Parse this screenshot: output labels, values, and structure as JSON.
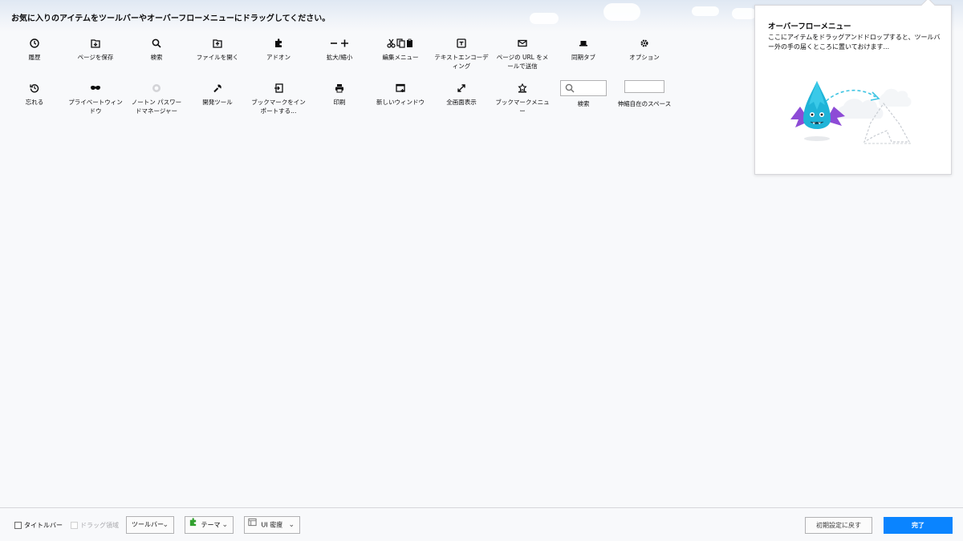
{
  "header": {
    "instructions": "お気に入りのアイテムをツールバーやオーバーフローメニューにドラッグしてください。"
  },
  "palette": {
    "row1": [
      {
        "icon": "clock-icon",
        "label": "履歴"
      },
      {
        "icon": "save-page-icon",
        "label": "ページを保存"
      },
      {
        "icon": "search-icon",
        "label": "検索"
      },
      {
        "icon": "open-file-icon",
        "label": "ファイルを開く"
      },
      {
        "icon": "puzzle-icon",
        "label": "アドオン"
      },
      {
        "icon": "zoom-icon",
        "label": "拡大/縮小"
      },
      {
        "icon": "edit-icon",
        "label": "編集メニュー"
      },
      {
        "icon": "text-encoding-icon",
        "label": "テキストエンコーディング"
      },
      {
        "icon": "mail-icon",
        "label": "ページの URL をメールで送信"
      },
      {
        "icon": "synced-tabs-icon",
        "label": "同期タブ"
      },
      {
        "icon": "gear-icon",
        "label": "オプション"
      }
    ],
    "row2": [
      {
        "icon": "forget-icon",
        "label": "忘れる"
      },
      {
        "icon": "private-mask-icon",
        "label": "プライベートウィンドウ"
      },
      {
        "icon": "norton-icon",
        "label": "ノートン パスワードマネージャー"
      },
      {
        "icon": "wrench-icon",
        "label": "開発ツール"
      },
      {
        "icon": "import-icon",
        "label": "ブックマークをインポートする..."
      },
      {
        "icon": "print-icon",
        "label": "印刷"
      },
      {
        "icon": "new-window-icon",
        "label": "新しいウィンドウ"
      },
      {
        "icon": "fullscreen-icon",
        "label": "全画面表示"
      },
      {
        "icon": "bookmark-menu-icon",
        "label": "ブックマークメニュー"
      },
      {
        "icon": "search-box-icon",
        "label": "検索"
      },
      {
        "icon": "flexible-space-icon",
        "label": "伸縮自在のスペース"
      }
    ]
  },
  "overflow_panel": {
    "title": "オーバーフローメニュー",
    "description": "ここにアイテムをドラッグアンドドロップすると、ツールバー外の手の届くところに置いておけます..."
  },
  "footer": {
    "title_bar_label": "タイトルバー",
    "drag_space_label": "ドラッグ領域",
    "toolbars_label": "ツールバー",
    "themes_label": "テーマ",
    "density_label": "UI 密度",
    "reset_label": "初期設定に戻す",
    "done_label": "完了"
  },
  "colors": {
    "accent": "#0a84ff",
    "background": "#f8f9fb",
    "icon": "#0c0c0d",
    "theme_icon": "#31a02e",
    "illustration_blue": "#1fb4d8",
    "illustration_purple": "#8d4bd6"
  }
}
